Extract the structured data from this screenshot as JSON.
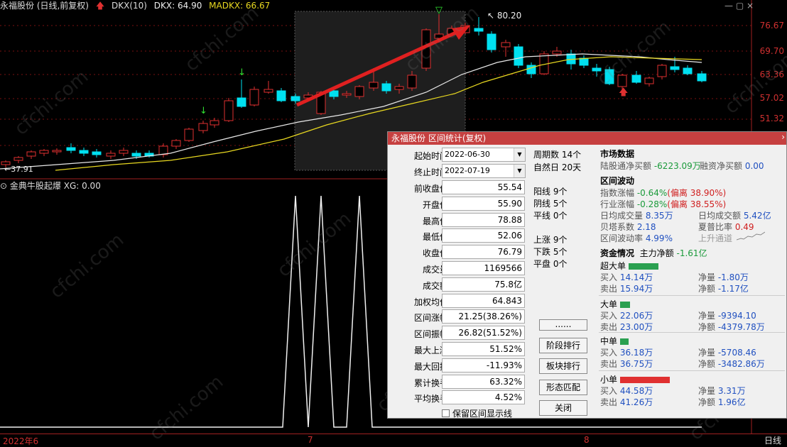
{
  "header": {
    "stock": "永福股份 (日线,前复权)",
    "dkx_name": "DKX(10)",
    "dkx": "DKX: 64.90",
    "madkx": "MADKX: 66.67"
  },
  "indicator": {
    "name": "金典牛股起爆",
    "xg": "XG: 0.00"
  },
  "price_labels": [
    "76.67",
    "69.70",
    "63.36",
    "57.02",
    "51.32"
  ],
  "annotations": {
    "high": "80.20",
    "low": "37.91"
  },
  "axis": {
    "d1": "2022年6",
    "d2": "7",
    "d3": "8",
    "period": "日线"
  },
  "colors": {
    "up": "#e03030",
    "down": "#00e0f0",
    "ma1": "#e8e8e8",
    "ma2": "#e8d820",
    "arrow": "#e02020"
  },
  "dialog": {
    "title": "永福股份 区间统计(复权)",
    "start_label": "起始时间",
    "start": "2022-06-30",
    "end_label": "终止时间",
    "end": "2022-07-19",
    "stats": [
      {
        "label": "前收盘价",
        "value": "55.54"
      },
      {
        "label": "开盘价",
        "value": "55.90"
      },
      {
        "label": "最高价",
        "value": "78.88"
      },
      {
        "label": "最低价",
        "value": "52.06"
      },
      {
        "label": "收盘价",
        "value": "76.79"
      },
      {
        "label": "成交量",
        "value": "1169566"
      },
      {
        "label": "成交额",
        "value": "75.8亿"
      },
      {
        "label": "加权均价",
        "value": "64.843"
      },
      {
        "label": "区间涨幅",
        "value": "21.25(38.26%)"
      },
      {
        "label": "区间振幅",
        "value": "26.82(51.52%)"
      },
      {
        "label": "最大上涨",
        "value": "51.52%"
      },
      {
        "label": "最大回撤",
        "value": "-11.93%"
      },
      {
        "label": "累计换手",
        "value": "63.32%"
      },
      {
        "label": "平均换手",
        "value": "4.52%"
      }
    ],
    "checkbox": "保留区间显示线",
    "mid": {
      "periods": "周期数 14个",
      "days": "自然日 20天",
      "yang": "阳线 9个",
      "yin": "阴线 5个",
      "flat": "平线 0个",
      "up": "上涨 9个",
      "down": "下跌 5个",
      "level": "平盘 0个"
    },
    "buttons": [
      "......",
      "阶段排行",
      "板块排行",
      "形态匹配",
      "关闭"
    ],
    "market": {
      "title": "市场数据",
      "lgt_label": "陆股通净买额",
      "lgt": "-6223.09万",
      "rz_label": "融资净买额",
      "rz": "0.00"
    },
    "wave": {
      "title": "区间波动",
      "idx_label": "指数涨幅",
      "idx": "-0.64%",
      "idx_dev": "(偏离 38.90%)",
      "ind_label": "行业涨幅",
      "ind": "-0.28%",
      "ind_dev": "(偏离 38.55%)",
      "avgvol_label": "日均成交量",
      "avgvol": "8.35万",
      "avgamt_label": "日均成交额",
      "avgamt": "5.42亿",
      "beta_label": "贝塔系数",
      "beta": "2.18",
      "sharpe_label": "夏普比率",
      "sharpe": "0.49",
      "volrate_label": "区间波动率",
      "volrate": "4.99%",
      "channel": "上升通道"
    },
    "funds": {
      "title": "资金情况",
      "main_label": "主力净额",
      "main": "-1.61亿",
      "groups": [
        {
          "name": "超大单",
          "buy": "14.14万",
          "sell": "15.94万",
          "net": "-1.80万",
          "netamt": "-1.17亿"
        },
        {
          "name": "大单",
          "buy": "22.06万",
          "sell": "23.00万",
          "net": "-9394.10",
          "netamt": "-4379.78万"
        },
        {
          "name": "中单",
          "buy": "36.18万",
          "sell": "36.75万",
          "net": "-5708.46",
          "netamt": "-3482.86万"
        },
        {
          "name": "小单",
          "buy": "44.58万",
          "sell": "41.26万",
          "net": "3.31万",
          "netamt": "1.96亿"
        }
      ],
      "buy_label": "买入",
      "sell_label": "卖出",
      "net_label": "净量",
      "netamt_label": "净额"
    }
  },
  "watermark": "cfchi.com"
}
